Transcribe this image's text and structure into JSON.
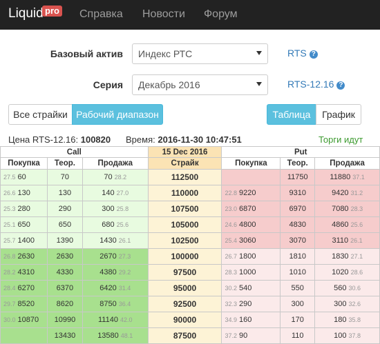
{
  "nav": {
    "brand": "Liquid",
    "badge": "pro",
    "links": [
      "Справка",
      "Новости",
      "Форум"
    ]
  },
  "form": {
    "asset_label": "Базовый актив",
    "asset_value": "Индекс РТС",
    "asset_link": "RTS",
    "series_label": "Серия",
    "series_value": "Декабрь 2016",
    "series_link": "RTS-12.16"
  },
  "buttons": {
    "all_strikes": "Все страйки",
    "working_range": "Рабочий диапазон",
    "table": "Таблица",
    "chart": "График"
  },
  "status": {
    "price_label": "Цена RTS-12.16:",
    "price_value": "100820",
    "time_label": "Время:",
    "time_value": "2016-11-30 10:47:51",
    "trading": "Торги идут"
  },
  "board": {
    "call_header": "Call",
    "date_header": "15 Dec 2016",
    "put_header": "Put",
    "col_bid": "Покупка",
    "col_theor": "Теор.",
    "col_ask": "Продажа",
    "col_strike": "Страйк",
    "rows": [
      {
        "c_bid_iv": "27.5",
        "c_bid": "60",
        "c_theor": "70",
        "c_ask": "70",
        "c_ask_iv": "28.2",
        "strike": "112500",
        "p_bid_iv": "",
        "p_bid": "",
        "p_theor": "11750",
        "p_ask": "11880",
        "p_ask_iv": "37.1"
      },
      {
        "c_bid_iv": "26.6",
        "c_bid": "130",
        "c_theor": "130",
        "c_ask": "140",
        "c_ask_iv": "27.0",
        "strike": "110000",
        "p_bid_iv": "22.8",
        "p_bid": "9220",
        "p_theor": "9310",
        "p_ask": "9420",
        "p_ask_iv": "31.2"
      },
      {
        "c_bid_iv": "25.3",
        "c_bid": "280",
        "c_theor": "290",
        "c_ask": "300",
        "c_ask_iv": "25.8",
        "strike": "107500",
        "p_bid_iv": "23.0",
        "p_bid": "6870",
        "p_theor": "6970",
        "p_ask": "7080",
        "p_ask_iv": "28.3"
      },
      {
        "c_bid_iv": "25.1",
        "c_bid": "650",
        "c_theor": "650",
        "c_ask": "680",
        "c_ask_iv": "25.6",
        "strike": "105000",
        "p_bid_iv": "24.6",
        "p_bid": "4800",
        "p_theor": "4830",
        "p_ask": "4860",
        "p_ask_iv": "25.6"
      },
      {
        "c_bid_iv": "25.7",
        "c_bid": "1400",
        "c_theor": "1390",
        "c_ask": "1430",
        "c_ask_iv": "26.1",
        "strike": "102500",
        "p_bid_iv": "25.4",
        "p_bid": "3060",
        "p_theor": "3070",
        "p_ask": "3110",
        "p_ask_iv": "26.1"
      },
      {
        "c_bid_iv": "26.8",
        "c_bid": "2630",
        "c_theor": "2630",
        "c_ask": "2670",
        "c_ask_iv": "27.3",
        "strike": "100000",
        "p_bid_iv": "26.7",
        "p_bid": "1800",
        "p_theor": "1810",
        "p_ask": "1830",
        "p_ask_iv": "27.1"
      },
      {
        "c_bid_iv": "28.2",
        "c_bid": "4310",
        "c_theor": "4330",
        "c_ask": "4380",
        "c_ask_iv": "29.2",
        "strike": "97500",
        "p_bid_iv": "28.3",
        "p_bid": "1000",
        "p_theor": "1010",
        "p_ask": "1020",
        "p_ask_iv": "28.6"
      },
      {
        "c_bid_iv": "28.4",
        "c_bid": "6270",
        "c_theor": "6370",
        "c_ask": "6420",
        "c_ask_iv": "31.4",
        "strike": "95000",
        "p_bid_iv": "30.2",
        "p_bid": "540",
        "p_theor": "550",
        "p_ask": "560",
        "p_ask_iv": "30.6"
      },
      {
        "c_bid_iv": "29.7",
        "c_bid": "8520",
        "c_theor": "8620",
        "c_ask": "8750",
        "c_ask_iv": "36.4",
        "strike": "92500",
        "p_bid_iv": "32.3",
        "p_bid": "290",
        "p_theor": "300",
        "p_ask": "300",
        "p_ask_iv": "32.6"
      },
      {
        "c_bid_iv": "30.0",
        "c_bid": "10870",
        "c_theor": "10990",
        "c_ask": "11140",
        "c_ask_iv": "42.0",
        "strike": "90000",
        "p_bid_iv": "34.9",
        "p_bid": "160",
        "p_theor": "170",
        "p_ask": "180",
        "p_ask_iv": "35.8"
      },
      {
        "c_bid_iv": "",
        "c_bid": "",
        "c_theor": "13430",
        "c_ask": "13580",
        "c_ask_iv": "48.1",
        "strike": "87500",
        "p_bid_iv": "37.2",
        "p_bid": "90",
        "p_theor": "110",
        "p_ask": "100",
        "p_ask_iv": "37.8"
      }
    ]
  }
}
